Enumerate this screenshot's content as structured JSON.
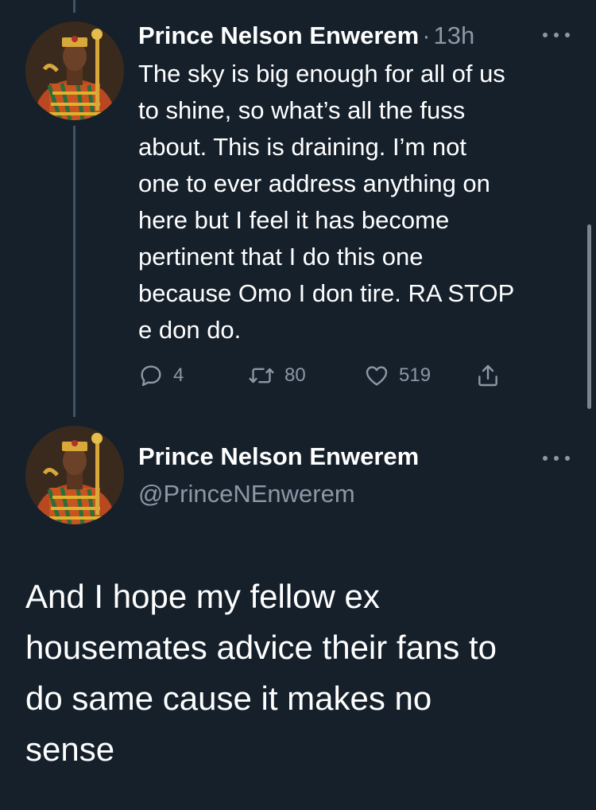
{
  "colors": {
    "background": "#15202b",
    "text_primary": "#ffffff",
    "text_secondary": "#8b98a5",
    "thread_line": "#3d5466"
  },
  "tweet1": {
    "author_name": "Prince Nelson Enwerem",
    "separator": "·",
    "timestamp": "13h",
    "text": "The sky is big enough for all of us\nto shine, so what’s all the fuss\nabout. This is draining. I’m not\none to ever address anything on\nhere but I feel it has become\npertinent that I do this one\nbecause Omo I don tire. RA STOP\ne don do.",
    "actions": {
      "reply_icon": "reply-bubble-icon",
      "reply_count": "4",
      "retweet_icon": "retweet-icon",
      "retweet_count": "80",
      "like_icon": "heart-icon",
      "like_count": "519",
      "share_icon": "share-upload-icon"
    },
    "more_icon": "more-dots-icon"
  },
  "tweet2": {
    "author_name": "Prince Nelson Enwerem",
    "handle": "@PrinceNEnwerem",
    "text": "And I hope my fellow ex\nhousemates advice their fans to\ndo same cause it makes no\nsense",
    "more_icon": "more-dots-icon"
  }
}
